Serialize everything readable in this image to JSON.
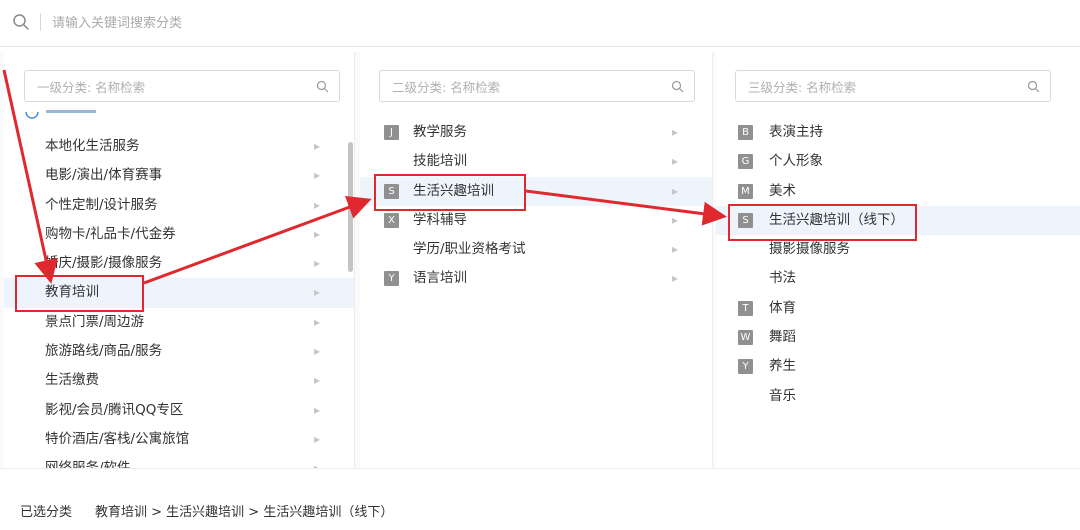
{
  "search": {
    "placeholder": "请输入关键词搜索分类"
  },
  "level1": {
    "placeholder": "一级分类: 名称检索",
    "items": [
      "本地化生活服务",
      "电影/演出/体育赛事",
      "个性定制/设计服务",
      "购物卡/礼品卡/代金券",
      "婚庆/摄影/摄像服务",
      "教育培训",
      "景点门票/周边游",
      "旅游路线/商品/服务",
      "生活缴费",
      "影视/会员/腾讯QQ专区",
      "特价酒店/客栈/公寓旅馆",
      "网络服务/软件"
    ],
    "selected_index": 5
  },
  "level2": {
    "placeholder": "二级分类: 名称检索",
    "items": [
      {
        "badge": "J",
        "label": "教学服务"
      },
      {
        "badge": "",
        "label": "技能培训"
      },
      {
        "badge": "S",
        "label": "生活兴趣培训"
      },
      {
        "badge": "X",
        "label": "学科辅导"
      },
      {
        "badge": "",
        "label": "学历/职业资格考试"
      },
      {
        "badge": "Y",
        "label": "语言培训"
      }
    ],
    "selected_index": 2
  },
  "level3": {
    "placeholder": "三级分类: 名称检索",
    "items": [
      {
        "badge": "B",
        "label": "表演主持"
      },
      {
        "badge": "G",
        "label": "个人形象"
      },
      {
        "badge": "M",
        "label": "美术"
      },
      {
        "badge": "S",
        "label": "生活兴趣培训（线下）"
      },
      {
        "badge": "",
        "label": "摄影摄像服务"
      },
      {
        "badge": "",
        "label": "书法"
      },
      {
        "badge": "T",
        "label": "体育"
      },
      {
        "badge": "W",
        "label": "舞蹈"
      },
      {
        "badge": "Y",
        "label": "养生"
      },
      {
        "badge": "",
        "label": "音乐"
      }
    ],
    "selected_index": 3
  },
  "footer": {
    "selected_label": "已选分类",
    "path": "教育培训 > 生活兴趣培训 > 生活兴趣培训（线下）"
  },
  "colors": {
    "accent_red": "#e0292e",
    "selected_bg": "#eef4fb",
    "badge_bg": "#909090"
  },
  "icons": {
    "search": "search-icon",
    "arrow": "chevron-right-icon"
  }
}
